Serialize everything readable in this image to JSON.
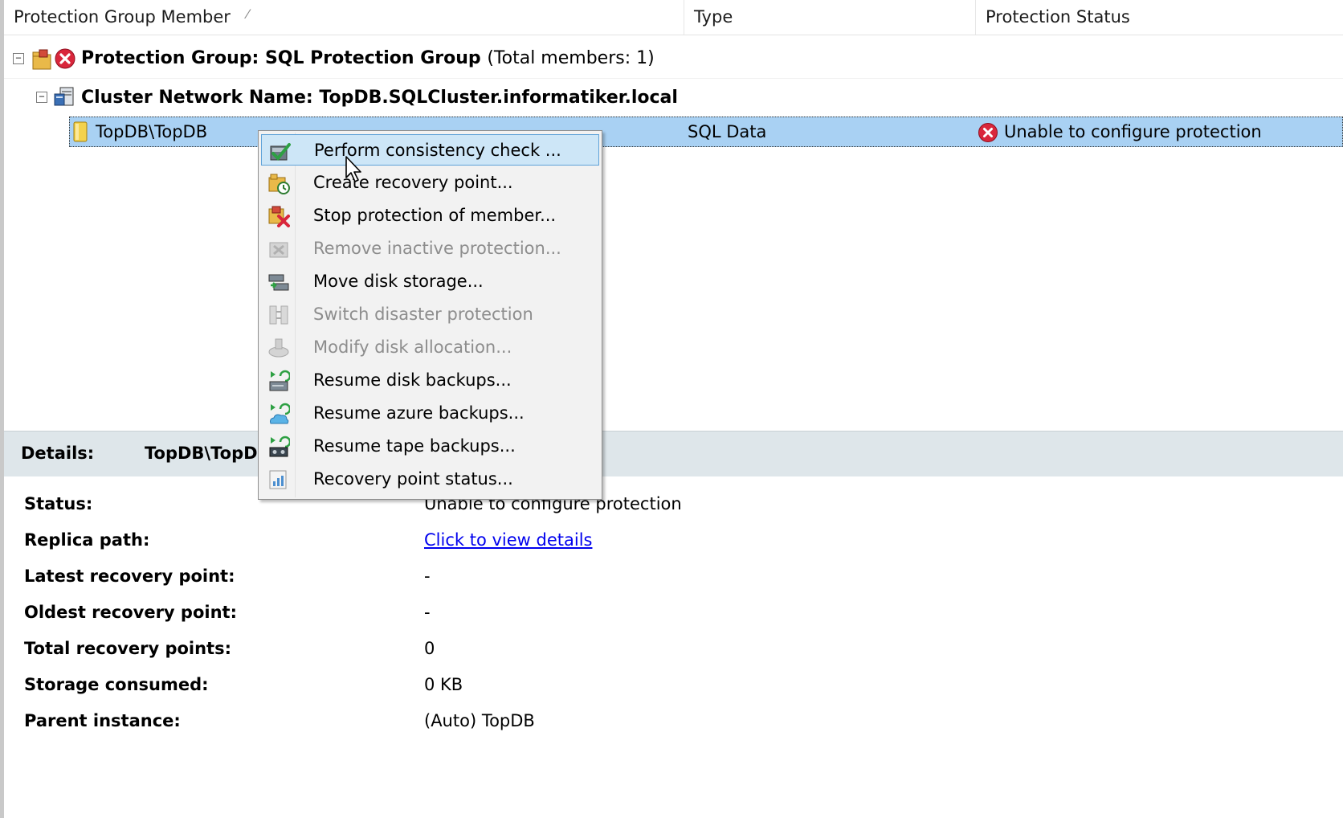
{
  "header": {
    "col_member": "Protection Group Member",
    "col_type": "Type",
    "col_status": "Protection Status"
  },
  "tree": {
    "group_title": "Protection Group: SQL Protection Group",
    "group_sub": "(Total members: 1)",
    "cluster_title": "Cluster Network Name: TopDB.SQLCluster.informatiker.local",
    "member": {
      "name": "TopDB\\TopDB",
      "type": "SQL Data",
      "status": "Unable to configure protection"
    }
  },
  "menu": {
    "items": [
      {
        "label": "Perform consistency check ...",
        "enabled": true,
        "icon": "consistency-check-icon"
      },
      {
        "label": "Create recovery point...",
        "enabled": true,
        "icon": "create-recovery-point-icon"
      },
      {
        "label": "Stop protection of member...",
        "enabled": true,
        "icon": "stop-protection-icon"
      },
      {
        "label": "Remove inactive protection...",
        "enabled": false,
        "icon": "remove-inactive-icon"
      },
      {
        "label": "Move disk storage...",
        "enabled": true,
        "icon": "move-disk-storage-icon"
      },
      {
        "label": "Switch disaster protection",
        "enabled": false,
        "icon": "switch-disaster-icon"
      },
      {
        "label": "Modify disk allocation...",
        "enabled": false,
        "icon": "modify-disk-icon"
      },
      {
        "label": "Resume disk backups...",
        "enabled": true,
        "icon": "resume-disk-icon"
      },
      {
        "label": "Resume azure backups...",
        "enabled": true,
        "icon": "resume-azure-icon"
      },
      {
        "label": "Resume tape backups...",
        "enabled": true,
        "icon": "resume-tape-icon"
      },
      {
        "label": "Recovery point status...",
        "enabled": true,
        "icon": "recovery-status-icon"
      }
    ]
  },
  "details": {
    "label": "Details:",
    "name": "TopDB\\TopDB",
    "fields": [
      {
        "label": "Status:",
        "value": "Unable to configure protection"
      },
      {
        "label": "Replica path:",
        "value": "Click to view details"
      },
      {
        "label": "Latest recovery point:",
        "value": "-"
      },
      {
        "label": "Oldest recovery point:",
        "value": "-"
      },
      {
        "label": "Total recovery points:",
        "value": "0"
      },
      {
        "label": "Storage consumed:",
        "value": "0 KB"
      },
      {
        "label": "Parent instance:",
        "value": "(Auto) TopDB"
      }
    ]
  },
  "colors": {
    "selection": "#a9d1f3",
    "menu_hot": "#cde6f7",
    "error": "#d9263b",
    "details_bar": "#dee6ea"
  }
}
